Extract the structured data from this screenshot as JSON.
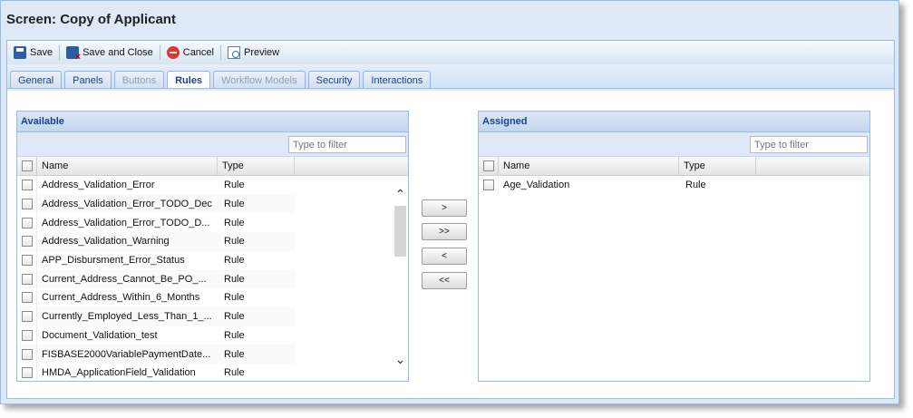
{
  "window": {
    "title": "Screen: Copy of Applicant"
  },
  "toolbar": {
    "save_label": "Save",
    "save_close_label": "Save and Close",
    "cancel_label": "Cancel",
    "preview_label": "Preview"
  },
  "tabs": [
    {
      "label": "General",
      "state": "normal"
    },
    {
      "label": "Panels",
      "state": "normal"
    },
    {
      "label": "Buttons",
      "state": "disabled"
    },
    {
      "label": "Rules",
      "state": "active"
    },
    {
      "label": "Workflow Models",
      "state": "disabled"
    },
    {
      "label": "Security",
      "state": "normal"
    },
    {
      "label": "Interactions",
      "state": "normal"
    }
  ],
  "available": {
    "title": "Available",
    "filter_placeholder": "Type to filter",
    "columns": {
      "name": "Name",
      "type": "Type"
    },
    "rows": [
      {
        "name": "Address_Validation_Error",
        "type": "Rule"
      },
      {
        "name": "Address_Validation_Error_TODO_Dec",
        "type": "Rule"
      },
      {
        "name": "Address_Validation_Error_TODO_D...",
        "type": "Rule"
      },
      {
        "name": "Address_Validation_Warning",
        "type": "Rule"
      },
      {
        "name": "APP_Disbursment_Error_Status",
        "type": "Rule"
      },
      {
        "name": "Current_Address_Cannot_Be_PO_...",
        "type": "Rule"
      },
      {
        "name": "Current_Address_Within_6_Months",
        "type": "Rule"
      },
      {
        "name": "Currently_Employed_Less_Than_1_...",
        "type": "Rule"
      },
      {
        "name": "Document_Validation_test",
        "type": "Rule"
      },
      {
        "name": "FISBASE2000VariablePaymentDate...",
        "type": "Rule"
      },
      {
        "name": "HMDA_ApplicationField_Validation",
        "type": "Rule"
      }
    ],
    "scroll_up_icon": "chevron-up-icon",
    "scroll_down_icon": "chevron-down-icon"
  },
  "assigned": {
    "title": "Assigned",
    "filter_placeholder": "Type to filter",
    "columns": {
      "name": "Name",
      "type": "Type"
    },
    "rows": [
      {
        "name": "Age_Validation",
        "type": "Rule"
      }
    ]
  },
  "move_buttons": {
    "add_one": ">",
    "add_all": ">>",
    "remove_one": "<",
    "remove_all": "<<"
  },
  "colors": {
    "header_text": "#15428b",
    "border": "#99bbe8",
    "panel_bg": "#dfe8f6"
  }
}
